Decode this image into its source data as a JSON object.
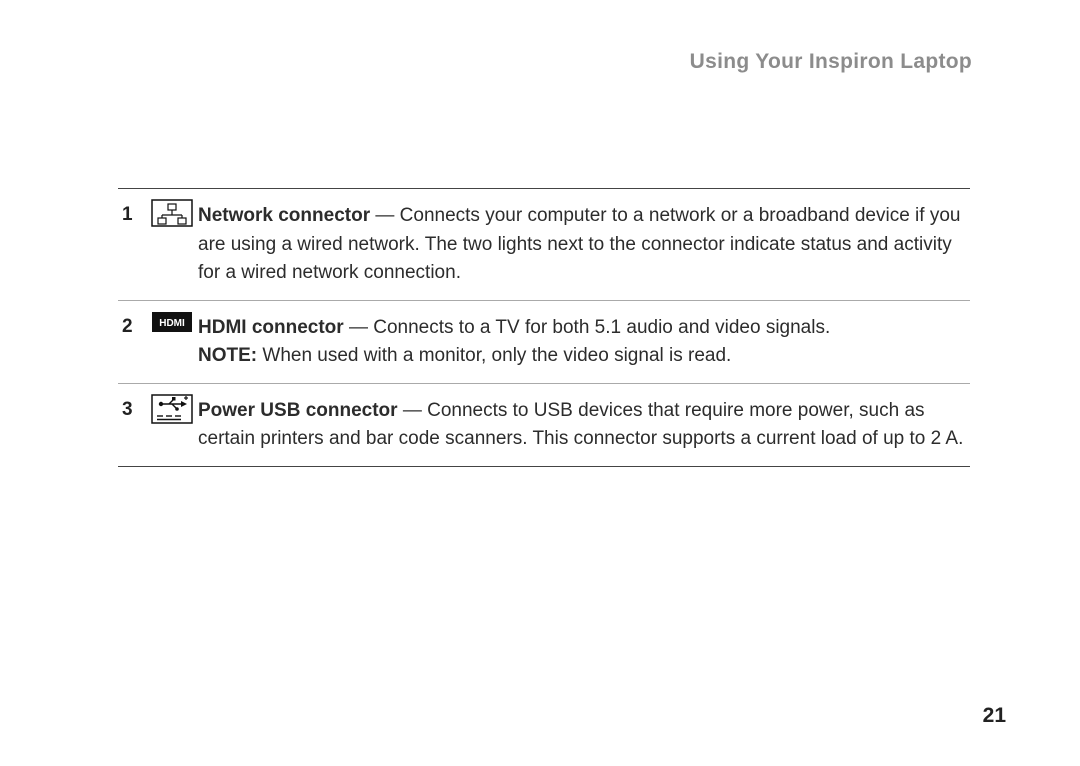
{
  "header": {
    "title": "Using Your Inspiron Laptop"
  },
  "rows": [
    {
      "num": "1",
      "title": "Network connector",
      "body": " — Connects your computer to a network or a broadband device if you are using a wired network. The two lights next to the connector indicate status and activity for a wired network connection."
    },
    {
      "num": "2",
      "title": "HDMI connector",
      "body": " — Connects to a TV for both 5.1 audio and video signals.",
      "note_label": "NOTE:",
      "note_body": " When used with a monitor, only the video signal is read."
    },
    {
      "num": "3",
      "title": "Power USB connector",
      "body": " — Connects to USB devices that require more power, such as certain printers and bar code scanners. This connector supports a current load of up to 2 A."
    }
  ],
  "page_number": "21"
}
